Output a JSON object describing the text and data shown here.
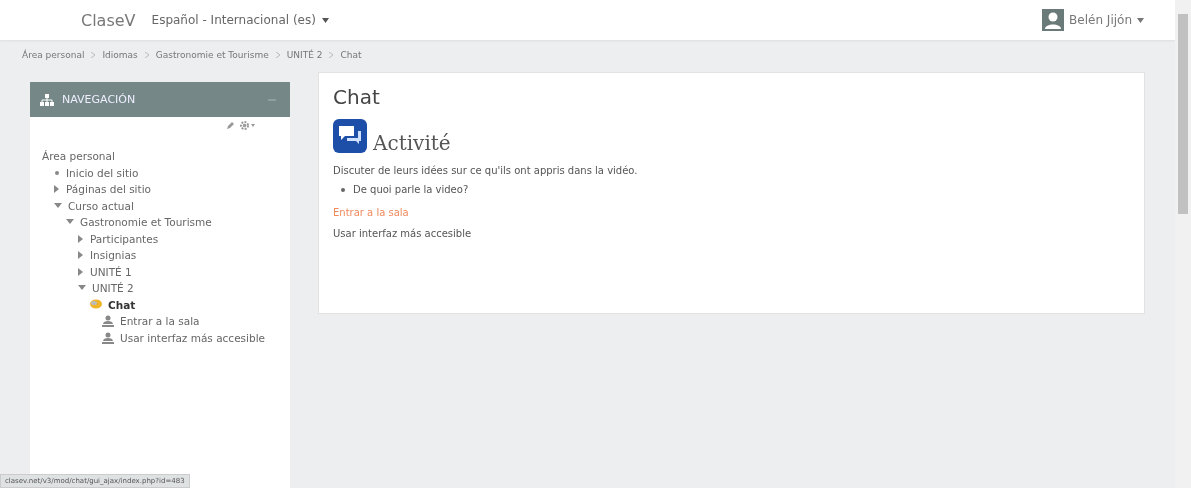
{
  "navbar": {
    "brand": "ClaseV",
    "language": "Español - Internacional (es)",
    "user": "Belén Jijón"
  },
  "breadcrumb": [
    "Área personal",
    "Idiomas",
    "Gastronomie et Tourisme",
    "UNITÉ 2",
    "Chat"
  ],
  "navigation": {
    "title": "NAVEGACIÓN",
    "items": [
      {
        "label": "Área personal",
        "children": [
          {
            "label": "Inicio del sitio",
            "kind": "leaf"
          },
          {
            "label": "Páginas del sitio",
            "kind": "branch",
            "expanded": false
          },
          {
            "label": "Curso actual",
            "kind": "branch",
            "expanded": true,
            "children": [
              {
                "label": "Gastronomie et Tourisme",
                "kind": "branch",
                "expanded": true,
                "children": [
                  {
                    "label": "Participantes",
                    "kind": "branch",
                    "expanded": false
                  },
                  {
                    "label": "Insignias",
                    "kind": "branch",
                    "expanded": false
                  },
                  {
                    "label": "UNITÉ 1",
                    "kind": "branch",
                    "expanded": false
                  },
                  {
                    "label": "UNITÉ 2",
                    "kind": "branch",
                    "expanded": true,
                    "children": [
                      {
                        "label": "Chat",
                        "kind": "activity",
                        "selected": true,
                        "children": [
                          {
                            "label": "Entrar a la sala",
                            "kind": "action",
                            "selected": false
                          },
                          {
                            "label": "Usar interfaz más accesible",
                            "kind": "action",
                            "selected": false
                          }
                        ]
                      }
                    ]
                  }
                ]
              }
            ]
          }
        ]
      }
    ]
  },
  "main": {
    "title": "Chat",
    "activity_title": "Activité",
    "description": "Discuter de leurs idées sur ce qu'ils ont appris dans la vidéo.",
    "bullets": [
      "De quoi parle la video?"
    ],
    "links": [
      {
        "label": "Entrar a la sala",
        "kind": "link"
      },
      {
        "label": "Usar interfaz más accesible",
        "kind": "text"
      }
    ]
  },
  "status_bar": "clasev.net/v3/mod/chat/gui_ajax/index.php?id=483"
}
